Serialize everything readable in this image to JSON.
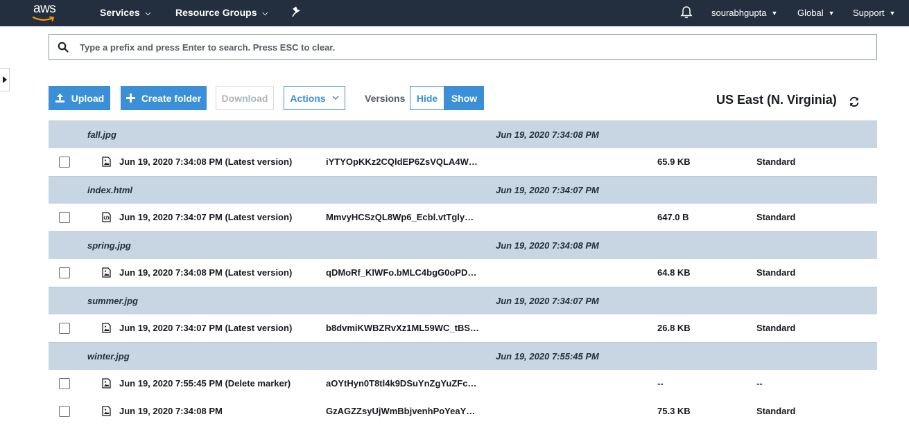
{
  "nav": {
    "logo": "aws",
    "services": "Services",
    "resource_groups": "Resource Groups",
    "user": "sourabhgupta",
    "region_menu": "Global",
    "support": "Support"
  },
  "search": {
    "placeholder": "Type a prefix and press Enter to search. Press ESC to clear."
  },
  "toolbar": {
    "upload": "Upload",
    "create_folder": "Create folder",
    "download": "Download",
    "actions": "Actions",
    "versions_label": "Versions",
    "hide": "Hide",
    "show": "Show",
    "region": "US East (N. Virginia)"
  },
  "colors": {
    "nav_bg": "#232f3e",
    "primary": "#3a8fd6",
    "group_row_bg": "#c7d6e2"
  },
  "objects": [
    {
      "name": "fall.jpg",
      "date": "Jun 19, 2020 7:34:08 PM",
      "versions": [
        {
          "icon": "image-file-icon",
          "date": "Jun 19, 2020 7:34:08 PM (Latest version)",
          "version_id": "iYTYOpKKz2CQldEP6ZsVQLA4W…",
          "size": "65.9 KB",
          "storage_class": "Standard"
        }
      ]
    },
    {
      "name": "index.html",
      "date": "Jun 19, 2020 7:34:07 PM",
      "versions": [
        {
          "icon": "code-file-icon",
          "date": "Jun 19, 2020 7:34:07 PM (Latest version)",
          "version_id": "MmvyHCSzQL8Wp6_Ecbl.vtTgly…",
          "size": "647.0 B",
          "storage_class": "Standard"
        }
      ]
    },
    {
      "name": "spring.jpg",
      "date": "Jun 19, 2020 7:34:08 PM",
      "versions": [
        {
          "icon": "image-file-icon",
          "date": "Jun 19, 2020 7:34:08 PM (Latest version)",
          "version_id": "qDMoRf_KlWFo.bMLC4bgG0oPD…",
          "size": "64.8 KB",
          "storage_class": "Standard"
        }
      ]
    },
    {
      "name": "summer.jpg",
      "date": "Jun 19, 2020 7:34:07 PM",
      "versions": [
        {
          "icon": "image-file-icon",
          "date": "Jun 19, 2020 7:34:07 PM (Latest version)",
          "version_id": "b8dvmiKWBZRvXz1ML59WC_tBS…",
          "size": "26.8 KB",
          "storage_class": "Standard"
        }
      ]
    },
    {
      "name": "winter.jpg",
      "date": "Jun 19, 2020 7:55:45 PM",
      "versions": [
        {
          "icon": "image-file-icon",
          "date": "Jun 19, 2020 7:55:45 PM (Delete marker)",
          "version_id": "aOYtHyn0T8tl4k9DSuYnZgYuZFc…",
          "size": "--",
          "storage_class": "--"
        },
        {
          "icon": "image-file-icon",
          "date": "Jun 19, 2020 7:34:08 PM",
          "version_id": "GzAGZZsyUjWmBbjvenhPoYeaY…",
          "size": "75.3 KB",
          "storage_class": "Standard"
        }
      ]
    }
  ]
}
